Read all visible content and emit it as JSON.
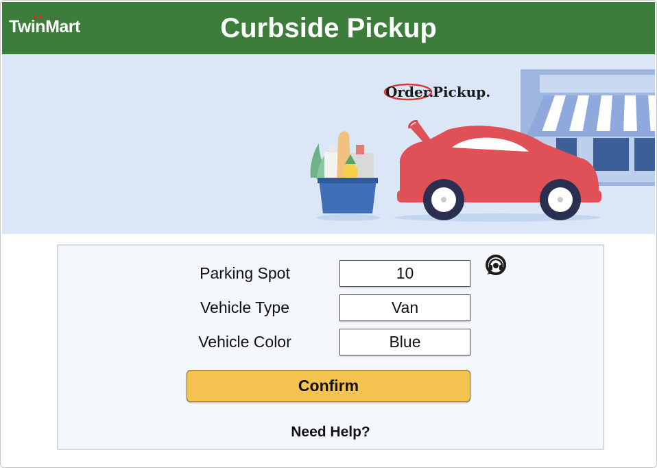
{
  "header": {
    "brand": "TwinMart",
    "title": "Curbside Pickup"
  },
  "banner": {
    "logo_word_1": "Order.",
    "logo_word_2": "Pickup."
  },
  "form": {
    "fields": [
      {
        "label": "Parking Spot",
        "value": "10"
      },
      {
        "label": "Vehicle Type",
        "value": "Van"
      },
      {
        "label": "Vehicle Color",
        "value": "Blue"
      }
    ],
    "confirm_label": "Confirm",
    "help_link": "Need Help?"
  },
  "colors": {
    "header_green": "#3d7d3b",
    "banner_blue": "#dbe7f6",
    "confirm_yellow": "#f3c24f",
    "car_red": "#e05157"
  },
  "icons": {
    "help": "headset-icon"
  }
}
